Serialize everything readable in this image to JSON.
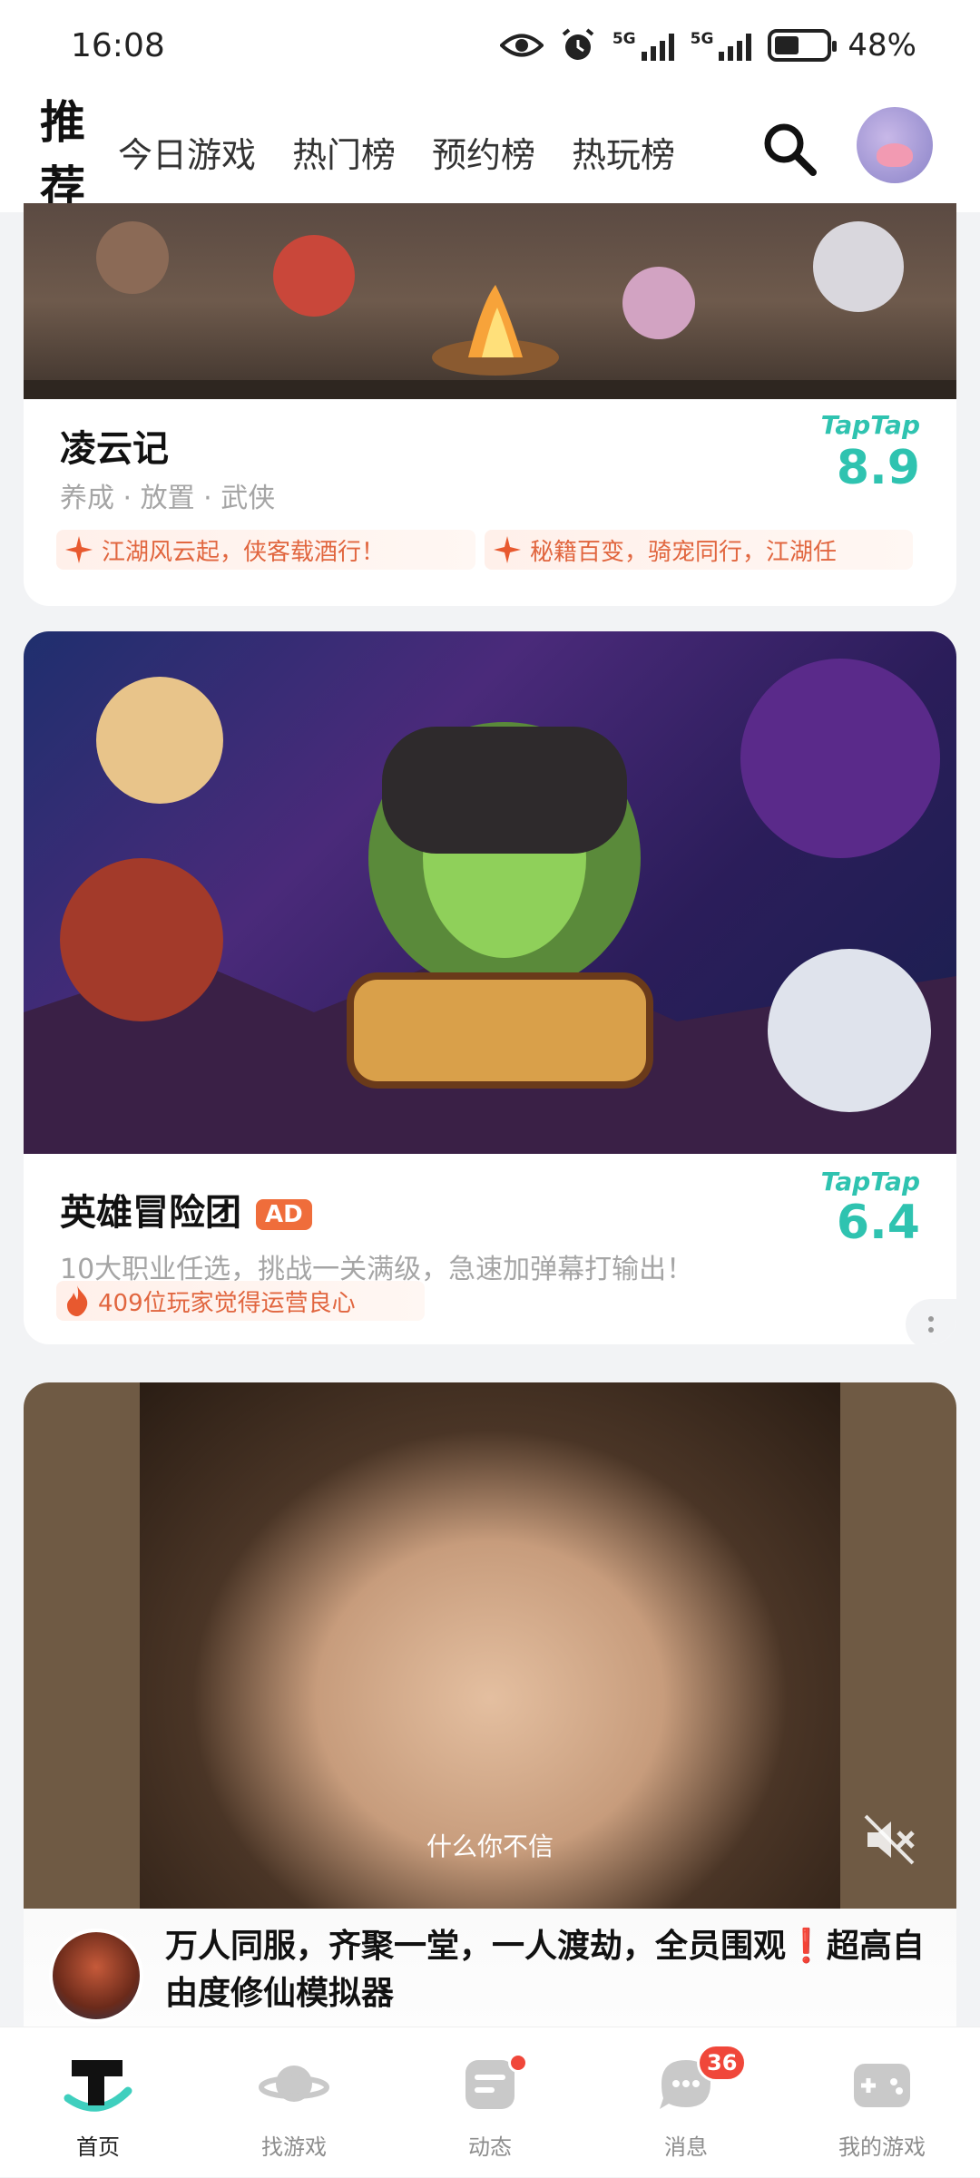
{
  "status_bar": {
    "time": "16:08",
    "signal1": "5G",
    "signal2": "5G",
    "battery_pct": 48,
    "battery_text": "48%"
  },
  "top_nav": {
    "active_tab": "推荐",
    "tabs": [
      "今日游戏",
      "热门榜",
      "预约榜",
      "热玩榜"
    ]
  },
  "cards": [
    {
      "title": "凌云记",
      "genres": "养成 · 放置 · 武侠",
      "score_brand": "TapTap",
      "score": "8.9",
      "tags": [
        "江湖风云起，侠客载酒行！",
        "秘籍百变，骑宠同行，江湖任"
      ]
    },
    {
      "title": "英雄冒险团",
      "ad_label": "AD",
      "desc": "10大职业任选，挑战一关满级，急速加弹幕打输出！",
      "score_brand": "TapTap",
      "score": "6.4",
      "tags": [
        "409位玩家觉得运营良心"
      ]
    }
  ],
  "video": {
    "caption": "什么你不信",
    "text": "万人同服，齐聚一堂，一人渡劫，全员围观❗超高自由度修仙模拟器"
  },
  "bottom_nav": {
    "items": [
      {
        "label": "首页",
        "active": true
      },
      {
        "label": "找游戏"
      },
      {
        "label": "动态",
        "dot": true
      },
      {
        "label": "消息",
        "badge": "36"
      },
      {
        "label": "我的游戏"
      }
    ]
  },
  "colors": {
    "accent": "#3fcfbe",
    "score": "#2fc3b0",
    "tag": "#e1663f",
    "badge": "#f0473a"
  }
}
